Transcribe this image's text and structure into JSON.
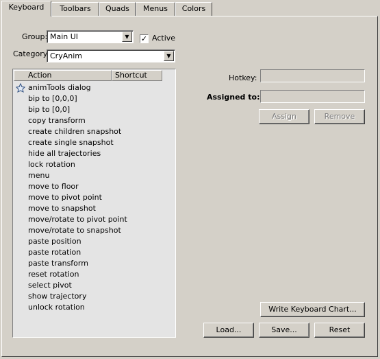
{
  "tabs": [
    {
      "label": "Keyboard"
    },
    {
      "label": "Toolbars"
    },
    {
      "label": "Quads"
    },
    {
      "label": "Menus"
    },
    {
      "label": "Colors"
    }
  ],
  "group": {
    "label": "Group:",
    "value": "Main UI"
  },
  "active": {
    "label": "Active",
    "checked": true
  },
  "category": {
    "label": "Category:",
    "value": "CryAnim"
  },
  "list": {
    "col_action": "Action",
    "col_shortcut": "Shortcut",
    "items": [
      "animTools dialog",
      "bip to [0,0,0]",
      "bip to [0,0]",
      "copy transform",
      "create children snapshot",
      "create single snapshot",
      "hide all trajectories",
      "lock rotation",
      "menu",
      "move to floor",
      "move to pivot point",
      "move to snapshot",
      "move/rotate to pivot point",
      "move/rotate to snapshot",
      "paste position",
      "paste rotation",
      "paste transform",
      "reset rotation",
      "select pivot",
      "show trajectory",
      "unlock rotation"
    ]
  },
  "hotkey": {
    "label": "Hotkey:",
    "value": ""
  },
  "assigned": {
    "label": "Assigned to:",
    "value": ""
  },
  "buttons": {
    "assign": "Assign",
    "remove": "Remove",
    "write_chart": "Write Keyboard Chart...",
    "load": "Load...",
    "save": "Save...",
    "reset": "Reset"
  }
}
